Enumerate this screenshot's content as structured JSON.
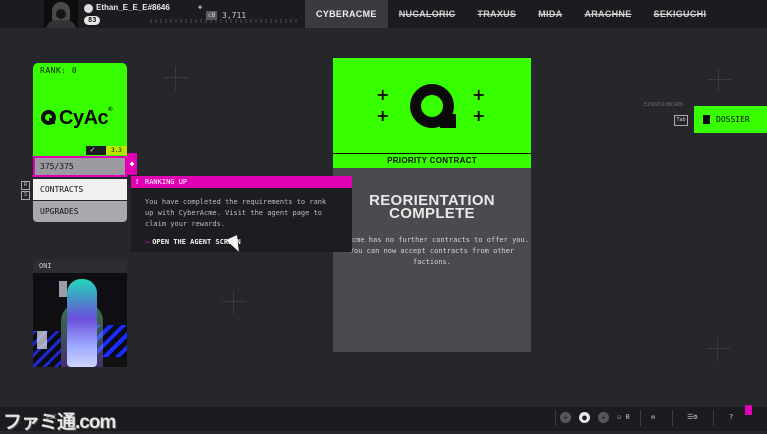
{
  "player": {
    "name": "Ethan_E_E_E#8646",
    "level": "83",
    "credits_icon": "cB",
    "credits": "3,711"
  },
  "factions": [
    {
      "label": "CYBERACME",
      "active": true
    },
    {
      "label": "NUCALORIC",
      "active": false
    },
    {
      "label": "TRAXUS",
      "active": false
    },
    {
      "label": "MIDA",
      "active": false
    },
    {
      "label": "ARACHNE",
      "active": false
    },
    {
      "label": "SEKIGUCHI",
      "active": false
    }
  ],
  "rank_card": {
    "rank_label": "RANK: 0",
    "logo_text": "CyAc",
    "logo_reg": "®",
    "check": "✓",
    "level_tag": "3.3"
  },
  "menu": {
    "progress": "375/375",
    "contracts": "CONTRACTS",
    "upgrades": "UPGRADES",
    "key_hint_top": "R",
    "key_hint_bottom": "S"
  },
  "tooltip": {
    "header": "RANKING UP",
    "bang": "!",
    "body": "You have completed the requirements to rank up with CyberAcme. Visit the agent page to claim your rewards.",
    "action": "OPEN THE AGENT SCREEN",
    "action_arrow": "→"
  },
  "oni": {
    "title": "ONI"
  },
  "contract": {
    "priority": "PRIORITY CONTRACT",
    "title": "REORIENTATION COMPLETE",
    "description": "berAcme has no further contracts to offer you. You can now accept contracts from other factions."
  },
  "dossier": {
    "label": "DOSSIER",
    "key": "Tab",
    "hex_id": "E29DA510BCAD6"
  },
  "bottom": {
    "watermark": "ファミ通.com",
    "esc_hint": "ESC",
    "party_count": "0",
    "help": "?"
  },
  "colors": {
    "accent_green": "#38ff00",
    "accent_pink": "#e100b4",
    "background": "#26272b"
  }
}
